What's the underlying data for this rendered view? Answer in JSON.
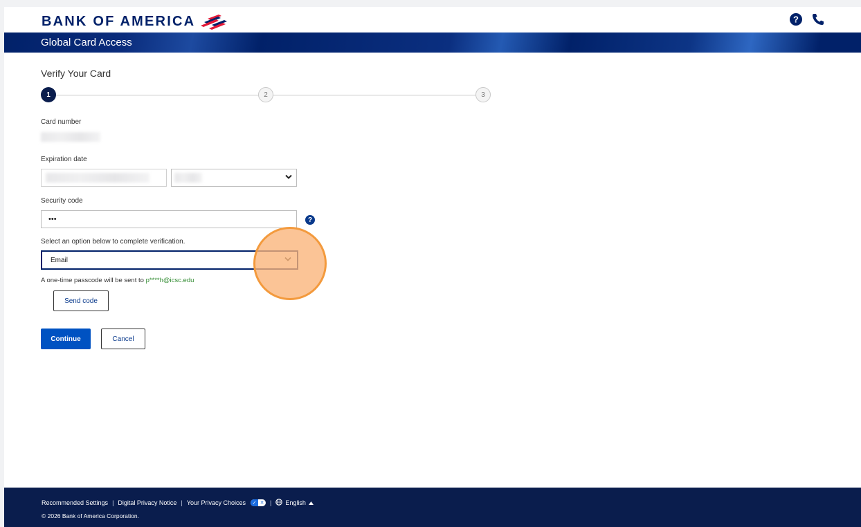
{
  "header": {
    "brand": "BANK OF AMERICA",
    "subtitle": "Global Card Access",
    "icons": [
      "help-icon",
      "phone-icon"
    ],
    "brand_color": "#012169"
  },
  "main": {
    "title": "Verify Your Card",
    "steps": [
      "1",
      "2",
      "3"
    ],
    "active_step": 1,
    "card_number_label": "Card number",
    "expiration_label": "Expiration date",
    "security_code_label": "Security code",
    "security_code_value": "•••",
    "option_prompt": "Select an option below to complete verification.",
    "option_selected": "Email",
    "otp_text": "A one-time passcode will be sent to ",
    "otp_email": "p****h@icsc.edu",
    "send_code_label": "Send code",
    "continue_label": "Continue",
    "cancel_label": "Cancel"
  },
  "footer": {
    "links": [
      "Recommended Settings",
      "Digital Privacy Notice",
      "Your Privacy Choices"
    ],
    "language": "English",
    "copyright": "© 2026 Bank of America Corporation."
  },
  "colors": {
    "accent": "#0052c2",
    "navy": "#0a1d4d",
    "highlight": "#f39a3d",
    "email_green": "#2f8a2f"
  }
}
